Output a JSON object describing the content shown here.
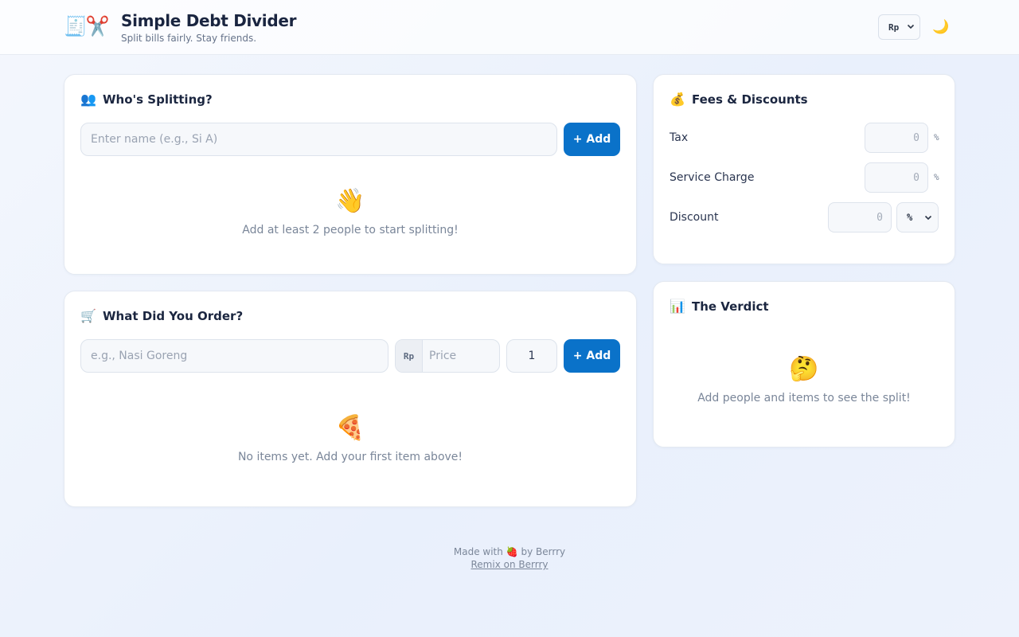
{
  "header": {
    "logo_icons": "🧾✂️",
    "title": "Simple Debt Divider",
    "subtitle": "Split bills fairly. Stay friends.",
    "currency_selected": "Rp",
    "theme_toggle_icon": "🌙"
  },
  "people_card": {
    "icon": "👥",
    "title": "Who's Splitting?",
    "name_input": {
      "placeholder": "Enter name (e.g., Si A)",
      "value": ""
    },
    "add_button": "+ Add",
    "empty_icon": "👋",
    "empty_message": "Add at least 2 people to start splitting!"
  },
  "order_card": {
    "icon": "🛒",
    "title": "What Did You Order?",
    "item_input": {
      "placeholder": "e.g., Nasi Goreng",
      "value": ""
    },
    "currency_prefix": "Rp",
    "price_input": {
      "placeholder": "Price",
      "value": ""
    },
    "quantity": "1",
    "add_button": "+ Add",
    "empty_icon": "🍕",
    "empty_message": "No items yet. Add your first item above!"
  },
  "fees_card": {
    "icon": "💰",
    "title": "Fees & Discounts",
    "tax": {
      "label": "Tax",
      "placeholder": "0",
      "unit": "%"
    },
    "service": {
      "label": "Service Charge",
      "placeholder": "0",
      "unit": "%"
    },
    "discount": {
      "label": "Discount",
      "placeholder": "0",
      "type_selected": "%"
    }
  },
  "verdict_card": {
    "icon": "📊",
    "title": "The Verdict",
    "empty_icon": "🤔",
    "empty_message": "Add people and items to see the split!"
  },
  "footer": {
    "made_with_prefix": "Made with",
    "heart_icon": "🍓",
    "made_with_suffix": "by Berrry",
    "remix_link": "Remix on Berrry"
  },
  "colors": {
    "accent": "#0a72c9",
    "background": "#edf2fc",
    "card": "#ffffff"
  }
}
